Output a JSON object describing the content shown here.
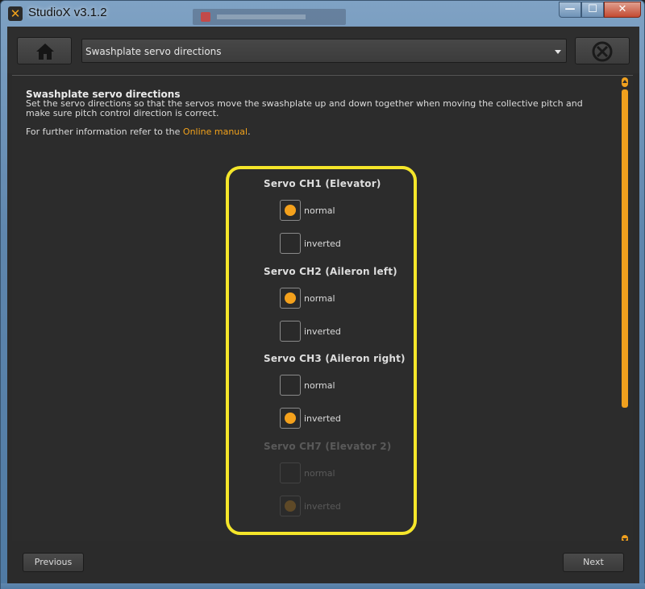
{
  "window": {
    "title": "StudioX v3.1.2",
    "minimize": "—",
    "maximize": "☐",
    "close": "✕"
  },
  "toolbar": {
    "page_select_value": "Swashplate servo directions",
    "home_icon": "home-icon",
    "stop_icon": "stop-icon"
  },
  "main": {
    "heading": "Swashplate servo directions",
    "description": "Set the servo directions so that the servos move the swashplate up and down together when moving the collective pitch and make sure pitch control direction is correct.",
    "more_info_prefix": "For further information refer to the ",
    "more_info_link": "Online manual",
    "more_info_suffix": "."
  },
  "groups": [
    {
      "title": "Servo CH1 (Elevator)",
      "normal": "normal",
      "inverted": "inverted",
      "selected": "normal",
      "enabled": true
    },
    {
      "title": "Servo CH2 (Aileron left)",
      "normal": "normal",
      "inverted": "inverted",
      "selected": "normal",
      "enabled": true
    },
    {
      "title": "Servo CH3 (Aileron right)",
      "normal": "normal",
      "inverted": "inverted",
      "selected": "inverted",
      "enabled": true
    },
    {
      "title": "Servo CH7 (Elevator 2)",
      "normal": "normal",
      "inverted": "inverted",
      "selected": "inverted",
      "enabled": false
    }
  ],
  "footer": {
    "previous": "Previous",
    "next": "Next"
  },
  "colors": {
    "accent": "#f4a11c",
    "highlight": "#f5e62a",
    "background": "#2c2c2c"
  }
}
